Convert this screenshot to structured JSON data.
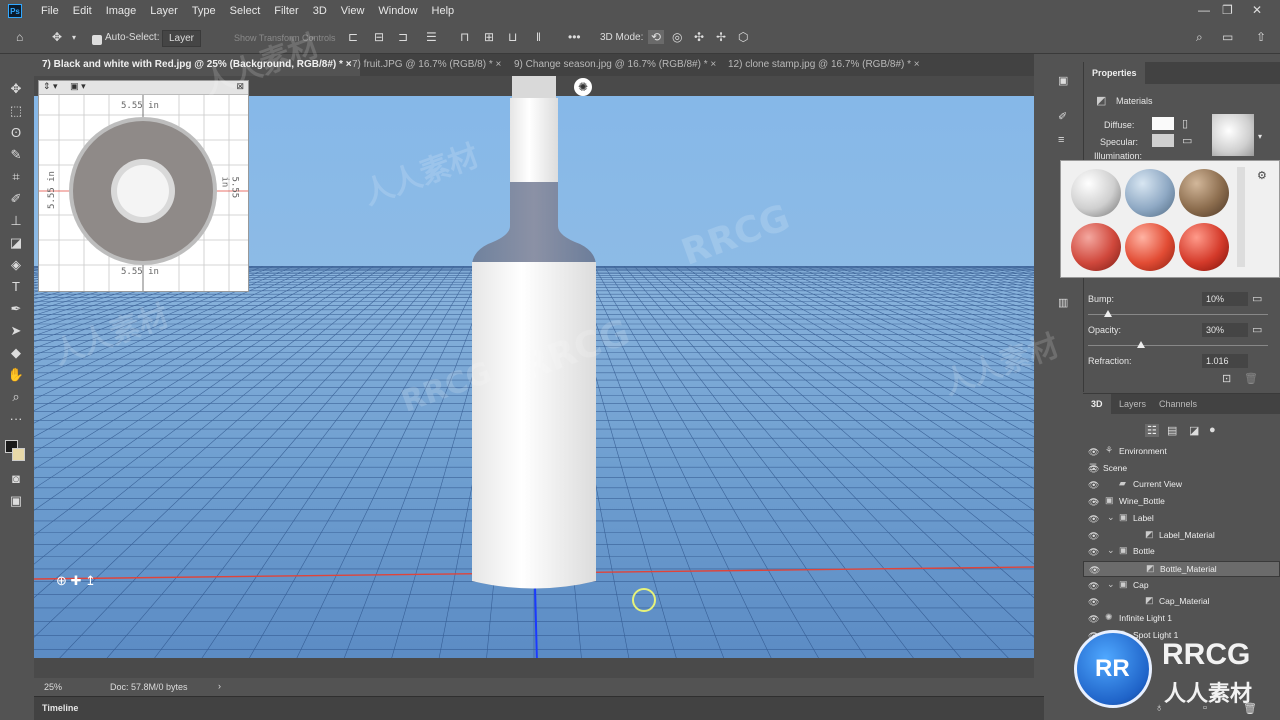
{
  "menu": [
    "File",
    "Edit",
    "Image",
    "Layer",
    "Type",
    "Select",
    "Filter",
    "3D",
    "View",
    "Window",
    "Help"
  ],
  "app_logo": "Ps",
  "options": {
    "auto_select_label": "Auto-Select:",
    "auto_select_value": "Layer",
    "show_transform": "Show Transform Controls",
    "mode_3d": "3D Mode:"
  },
  "tabs": [
    "7) Black and white with Red.jpg @ 25% (Background, RGB/8#) *",
    "7) fruit.JPG @ 16.7% (RGB/8) *",
    "9) Change season.jpg @ 16.7% (RGB/8#) *",
    "12) clone stamp.jpg @ 16.7% (RGB/8#) *"
  ],
  "navigator": {
    "dim_top": "5.55 in",
    "dim_bottom": "5.55 in",
    "dim_left": "5.55 in",
    "dim_right": "5.55 in"
  },
  "status": {
    "zoom": "25%",
    "doc": "Doc: 57.8M/0 bytes"
  },
  "timeline_label": "Timeline",
  "properties": {
    "title": "Properties",
    "section": "Materials",
    "diffuse": "Diffuse:",
    "specular": "Specular:",
    "illumination": "Illumination:",
    "bump_label": "Bump:",
    "bump_value": "10%",
    "opacity_label": "Opacity:",
    "opacity_value": "30%",
    "refraction_label": "Refraction:",
    "refraction_value": "1.016"
  },
  "panel_tabs": [
    "3D",
    "Layers",
    "Channels"
  ],
  "scene_tree": [
    {
      "label": "Environment",
      "icon": "environment-icon"
    },
    {
      "label": "Scene",
      "icon": "scene-icon"
    },
    {
      "label": "Current View",
      "icon": "camera-icon"
    },
    {
      "label": "Wine_Bottle",
      "icon": "mesh-icon"
    },
    {
      "label": "Label",
      "icon": "mesh-icon"
    },
    {
      "label": "Label_Material",
      "icon": "material-icon"
    },
    {
      "label": "Bottle",
      "icon": "mesh-icon"
    },
    {
      "label": "Bottle_Material",
      "icon": "material-icon",
      "selected": true
    },
    {
      "label": "Cap",
      "icon": "mesh-icon"
    },
    {
      "label": "Cap_Material",
      "icon": "material-icon"
    },
    {
      "label": "Infinite Light 1",
      "icon": "light-icon"
    },
    {
      "label": "Spot Light 1",
      "icon": "light-icon"
    }
  ],
  "watermarks": {
    "rrcg": "RRCG",
    "cn": "人人素材"
  },
  "colors": {
    "accent": "#31a8ff",
    "panel": "#535353",
    "sky": "#86b8e8",
    "grid_red": "#e0443a",
    "grid_blue": "#1a3aff"
  }
}
